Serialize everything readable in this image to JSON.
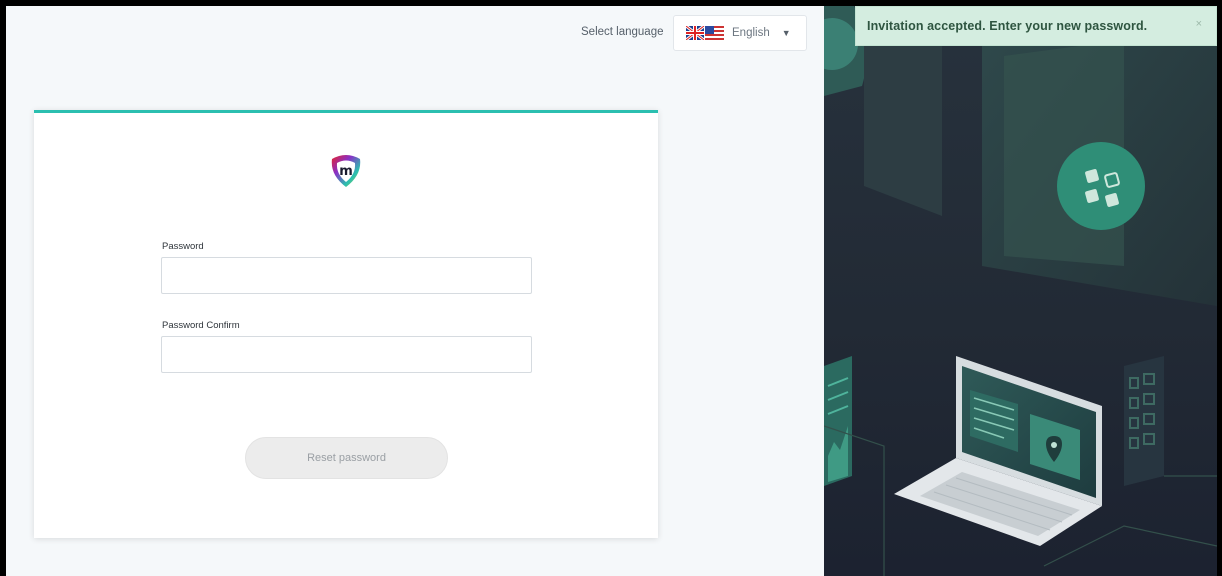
{
  "language": {
    "label": "Select language",
    "selected": "English",
    "flag_icons": [
      "uk-flag-icon",
      "us-flag-icon"
    ]
  },
  "form": {
    "logo_letter": "m",
    "password_label": "Password",
    "password_value": "",
    "password_confirm_label": "Password Confirm",
    "password_confirm_value": "",
    "reset_button": "Reset password"
  },
  "toast": {
    "message": "Invitation accepted. Enter your new password.",
    "close_glyph": "×"
  },
  "colors": {
    "accent": "#2bbfb0",
    "toast_bg": "#d4ede0",
    "hero_bg": "#1f2530"
  }
}
